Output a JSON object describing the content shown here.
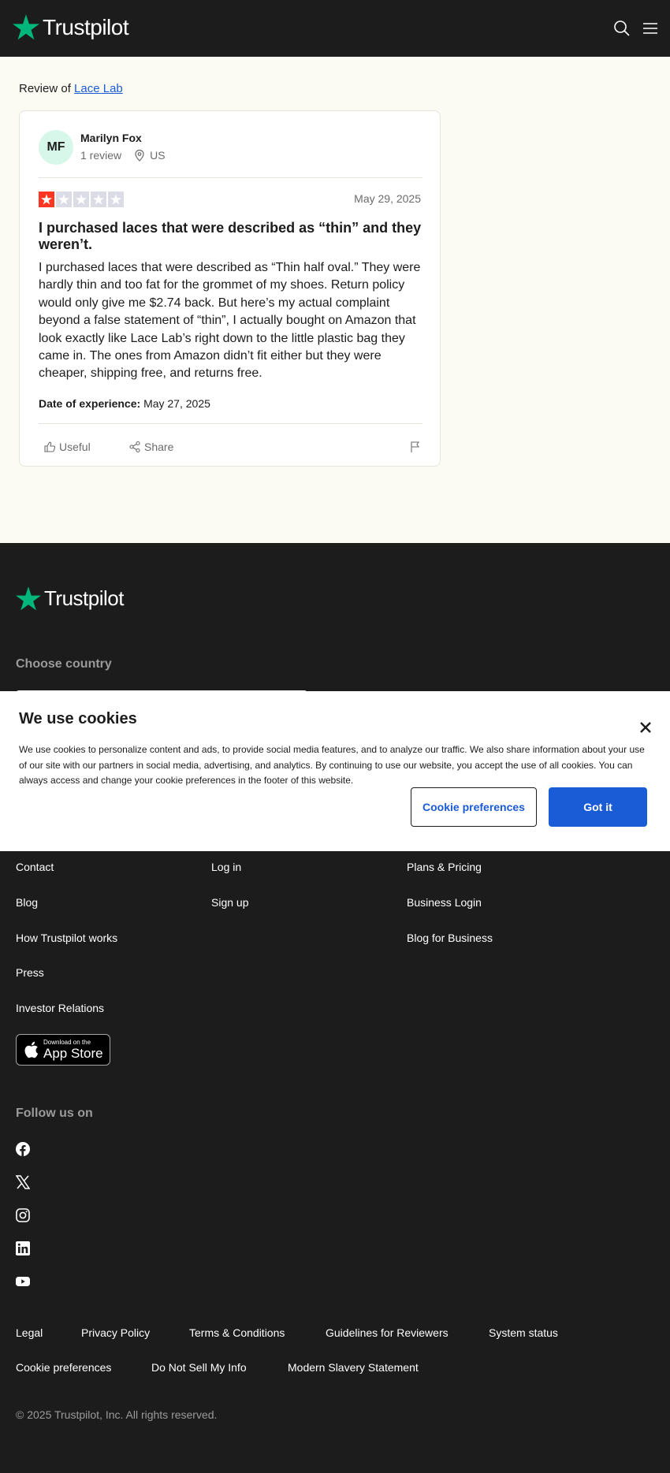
{
  "header": {
    "brand": "Trustpilot"
  },
  "review_page": {
    "review_of_prefix": "Review of",
    "company_name": "Lace Lab"
  },
  "reviewer": {
    "initials": "MF",
    "name": "Marilyn Fox",
    "review_count": "1 review",
    "country": "US"
  },
  "review": {
    "rating": 1,
    "rating_max": 5,
    "star_color": "#ff3722",
    "date": "May 29, 2025",
    "title": "I purchased laces that were described as “thin” and they weren’t.",
    "body": "I purchased laces that were described as “Thin half oval.” They were hardly thin and too fat for the grommet of my shoes. Return policy would only give me $2.74 back. But here’s my actual complaint beyond a false statement of “thin”, I actually bought on Amazon that look exactly like Lace Lab’s right down to the little plastic bag they came in. The ones from Amazon didn’t fit either but they were cheaper, shipping free, and returns free.",
    "experience_label": "Date of experience:",
    "experience_date": "May 27, 2025",
    "useful_label": "Useful",
    "share_label": "Share"
  },
  "footer": {
    "brand": "Trustpilot",
    "choose_country": "Choose country",
    "col1": [
      "Contact",
      "Blog",
      "How Trustpilot works",
      "Press",
      "Investor Relations"
    ],
    "col2": [
      "Log in",
      "Sign up"
    ],
    "col3": [
      "Plans & Pricing",
      "Business Login",
      "Blog for Business"
    ],
    "app_store_small": "Download on the",
    "app_store_big": "App Store",
    "follow_us": "Follow us on",
    "social_icons": [
      "facebook-icon",
      "x-icon",
      "instagram-icon",
      "linkedin-icon",
      "youtube-icon"
    ],
    "legal_row1": [
      "Legal",
      "Privacy Policy",
      "Terms & Conditions",
      "Guidelines for Reviewers",
      "System status"
    ],
    "legal_row2": [
      "Cookie preferences",
      "Do Not Sell My Info",
      "Modern Slavery Statement"
    ],
    "copyright": "© 2025 Trustpilot, Inc. All rights reserved."
  },
  "cookie_banner": {
    "title": "We use cookies",
    "text": "We use cookies to personalize content and ads, to provide social media features, and to analyze our traffic. We also share information about your use of our site with our partners in social media, advertising, and analytics. By continuing to use our website, you accept the use of all cookies. You can always access and change your cookie preferences in the footer of this website.",
    "preferences_button": "Cookie preferences",
    "accept_button": "Got it"
  },
  "colors": {
    "brand_green": "#00b67a",
    "link_blue": "#1a5bd6",
    "dark_bg": "#1c1c1c",
    "page_bg": "#fcfbf3"
  }
}
